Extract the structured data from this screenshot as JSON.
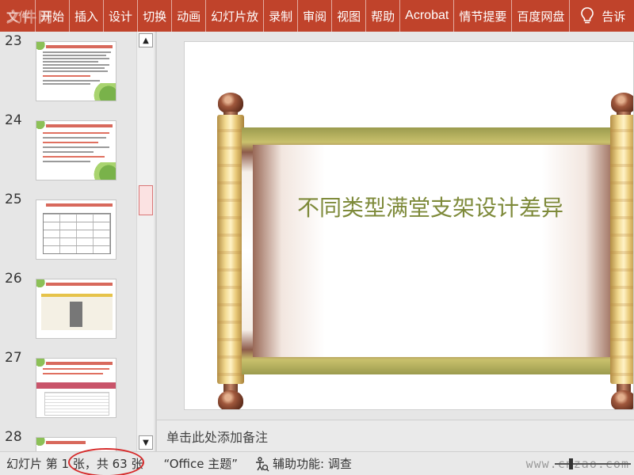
{
  "ribbon": {
    "tabs": [
      "文件",
      "开始",
      "插入",
      "设计",
      "切换",
      "动画",
      "幻灯片放",
      "录制",
      "审阅",
      "视图",
      "帮助",
      "Acrobat",
      "情节提要",
      "百度网盘"
    ],
    "tell_me": "告诉",
    "watermark": "文件网"
  },
  "thumbnails": [
    {
      "number": "23"
    },
    {
      "number": "24"
    },
    {
      "number": "25"
    },
    {
      "number": "26"
    },
    {
      "number": "27"
    },
    {
      "number": "28"
    }
  ],
  "slide": {
    "title": "不同类型满堂支架设计差异"
  },
  "notes": {
    "placeholder": "单击此处添加备注"
  },
  "status": {
    "slide_count": "幻灯片 第 1 张，共 63 张",
    "theme": "“Office 主题”",
    "accessibility": "辅助功能: 调查",
    "watermark": "www.cnzao.com"
  },
  "colors": {
    "ribbon": "#c0432b",
    "title_text": "#7e8a3a",
    "highlight_circle": "#d62b2b"
  }
}
